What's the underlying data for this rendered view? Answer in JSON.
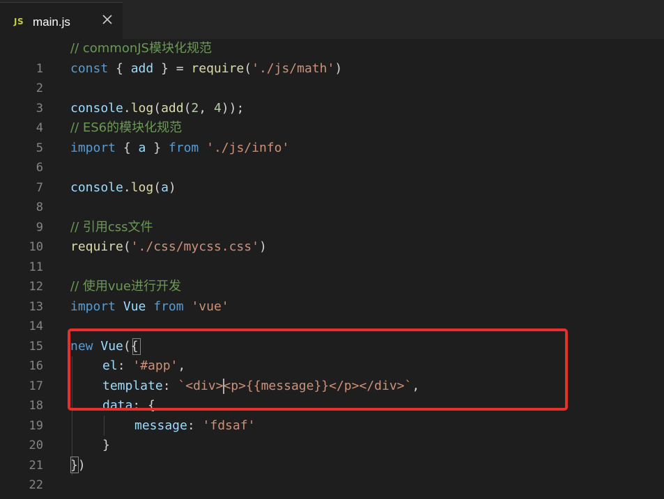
{
  "tab": {
    "icon_label": "JS",
    "title": "main.js",
    "close_glyph": "close-icon"
  },
  "colors": {
    "background": "#1e1e1e",
    "tabbar": "#252526",
    "comment": "#6a9955",
    "keyword": "#569cd6",
    "string": "#ce9178",
    "variable": "#9cdcfe",
    "function": "#dcdcaa",
    "number": "#b5cea8",
    "highlight_box": "#e8302a"
  },
  "code": {
    "line_numbers": [
      "1",
      "2",
      "3",
      "4",
      "5",
      "6",
      "7",
      "8",
      "9",
      "10",
      "11",
      "12",
      "13",
      "14",
      "15",
      "16",
      "17",
      "18",
      "19",
      "20",
      "21",
      "22"
    ],
    "l1": {
      "comment": "// commonJS模块化规范"
    },
    "l2": {
      "kw": "const",
      "open": " { ",
      "name": "add",
      "close": " } = ",
      "fn": "require",
      "p1": "(",
      "str": "'./js/math'",
      "p2": ")"
    },
    "l4": {
      "obj": "console",
      "dot": ".",
      "fn": "log",
      "p1": "(",
      "fn2": "add",
      "p2": "(",
      "n1": "2",
      "comma": ", ",
      "n2": "4",
      "p3": "));"
    },
    "l5": {
      "comment": "// ES6的模块化规范"
    },
    "l6": {
      "kw": "import",
      "open": " { ",
      "name": "a",
      "close": " } ",
      "from": "from",
      "sp": " ",
      "str": "'./js/info'"
    },
    "l8": {
      "obj": "console",
      "dot": ".",
      "fn": "log",
      "p1": "(",
      "arg": "a",
      "p2": ")"
    },
    "l10": {
      "comment": "// 引用css文件"
    },
    "l11": {
      "fn": "require",
      "p1": "(",
      "str": "'./css/mycss.css'",
      "p2": ")"
    },
    "l13": {
      "comment": "// 使用vue进行开发"
    },
    "l14": {
      "kw": "import",
      "sp1": " ",
      "name": "Vue",
      "sp2": " ",
      "from": "from",
      "sp3": " ",
      "str": "'vue'"
    },
    "l16": {
      "kw": "new",
      "sp": " ",
      "cls": "Vue",
      "p1": "(",
      "brace": "{"
    },
    "l17": {
      "key": "el",
      "colon": ": ",
      "str": "'#app'",
      "comma": ","
    },
    "l18": {
      "key": "template",
      "colon": ": ",
      "str_a": "`<div",
      "str_b": "><p>{{message}}</p></div>`",
      "comma": ","
    },
    "l19": {
      "key": "data",
      "colon": ": ",
      "brace": "{"
    },
    "l20": {
      "key": "message",
      "colon": ": ",
      "str": "'fdsaf'"
    },
    "l21": {
      "brace": "}"
    },
    "l22": {
      "brace": "}",
      "paren": ")"
    }
  }
}
